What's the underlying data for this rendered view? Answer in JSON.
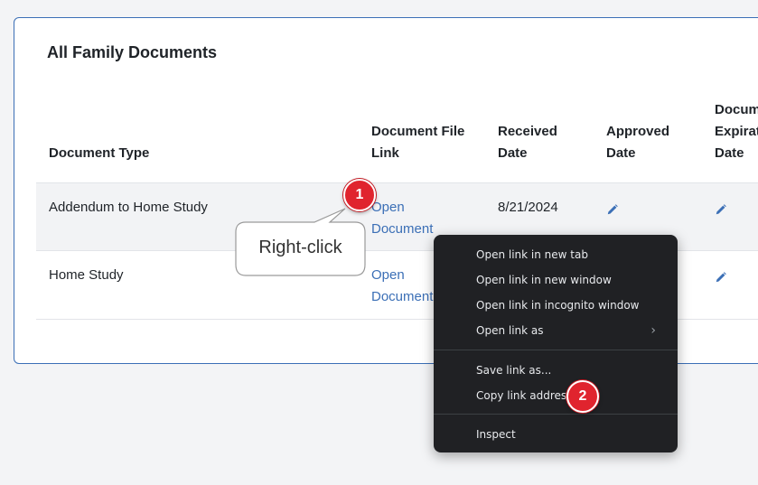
{
  "card": {
    "title": "All Family Documents"
  },
  "table": {
    "headers": {
      "document_type": "Document Type",
      "document_file_link": "Document File Link",
      "received_date": "Received Date",
      "approved_date": "Approved Date",
      "expiration_date": "Document Expiration Date"
    },
    "rows": [
      {
        "type": "Addendum to Home Study",
        "link": "Open Document",
        "received": "8/21/2024"
      },
      {
        "type": "Home Study",
        "link": "Open Document",
        "received": ""
      }
    ]
  },
  "context_menu": {
    "items": [
      {
        "label": "Open link in new tab"
      },
      {
        "label": "Open link in new window"
      },
      {
        "label": "Open link in incognito window"
      },
      {
        "label": "Open link as",
        "chevron": "chevron-right-icon"
      },
      {
        "label": "Save link as..."
      },
      {
        "label": "Copy link address"
      },
      {
        "label": "Inspect"
      }
    ]
  },
  "annotations": {
    "step1": "1",
    "step2": "2",
    "callout": "Right-click"
  },
  "colors": {
    "link": "#3b6fb6",
    "badge": "#e0242e",
    "menu_bg": "#202124"
  }
}
